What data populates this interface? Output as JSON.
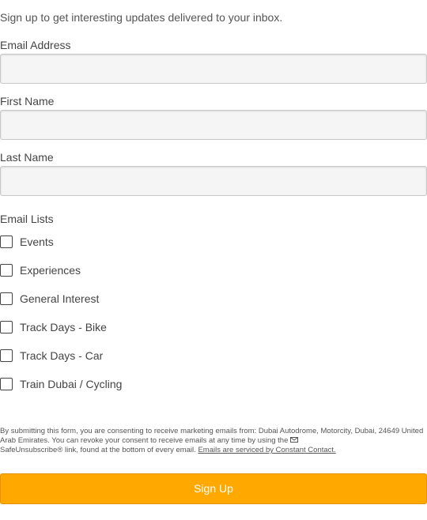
{
  "intro": "Sign up to get interesting updates delivered to your inbox.",
  "fields": {
    "email": {
      "label": "Email Address",
      "value": "",
      "placeholder": ""
    },
    "first_name": {
      "label": "First Name",
      "value": "",
      "placeholder": ""
    },
    "last_name": {
      "label": "Last Name",
      "value": "",
      "placeholder": ""
    }
  },
  "lists": {
    "label": "Email Lists",
    "items": [
      {
        "label": "Events",
        "checked": false
      },
      {
        "label": "Experiences",
        "checked": false
      },
      {
        "label": "General Interest",
        "checked": false
      },
      {
        "label": "Track Days - Bike",
        "checked": false
      },
      {
        "label": "Track Days - Car",
        "checked": false
      },
      {
        "label": "Train Dubai / Cycling",
        "checked": false
      }
    ]
  },
  "legal": {
    "text_before_icon": "By submitting this form, you are consenting to receive marketing emails from: Dubai Autodrome, Motorcity, Dubai, 24649 United Arab Emirates. You can revoke your consent to receive emails at any time by using the",
    "icon": "envelope-icon",
    "text_after_icon": "SafeUnsubscribe® link, found at the bottom of every email.",
    "link": "Emails are serviced by Constant Contact."
  },
  "submit_label": "Sign Up",
  "colors": {
    "button": "#ffa800",
    "input_bg": "#f5f5f5",
    "text": "#444444"
  }
}
